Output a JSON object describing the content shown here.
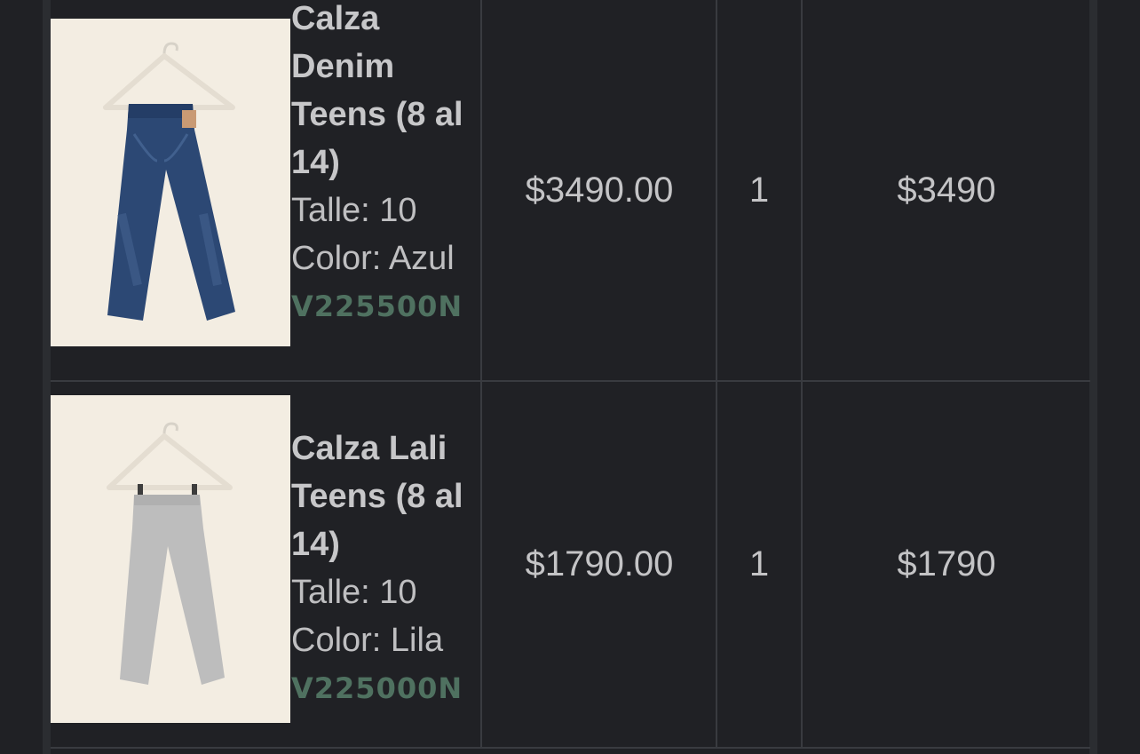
{
  "cart": {
    "items": [
      {
        "name": "Calza Denim Teens (8 al 14)",
        "size_label": "Talle: 10",
        "color_label": "Color: Azul",
        "sku": "V225500N",
        "unit_price": "$3490.00",
        "quantity": "1",
        "subtotal": "$3490",
        "image_icon": "denim-jeans-on-hanger"
      },
      {
        "name": "Calza Lali Teens (8 al 14)",
        "size_label": "Talle: 10",
        "color_label": "Color: Lila",
        "sku": "V225000N",
        "unit_price": "$1790.00",
        "quantity": "1",
        "subtotal": "$1790",
        "image_icon": "grey-leggings-on-hanger"
      }
    ]
  },
  "colors": {
    "background": "#202125",
    "grid_line": "#393b40",
    "text": "#c4c4c6",
    "sku": "#4f7160"
  }
}
